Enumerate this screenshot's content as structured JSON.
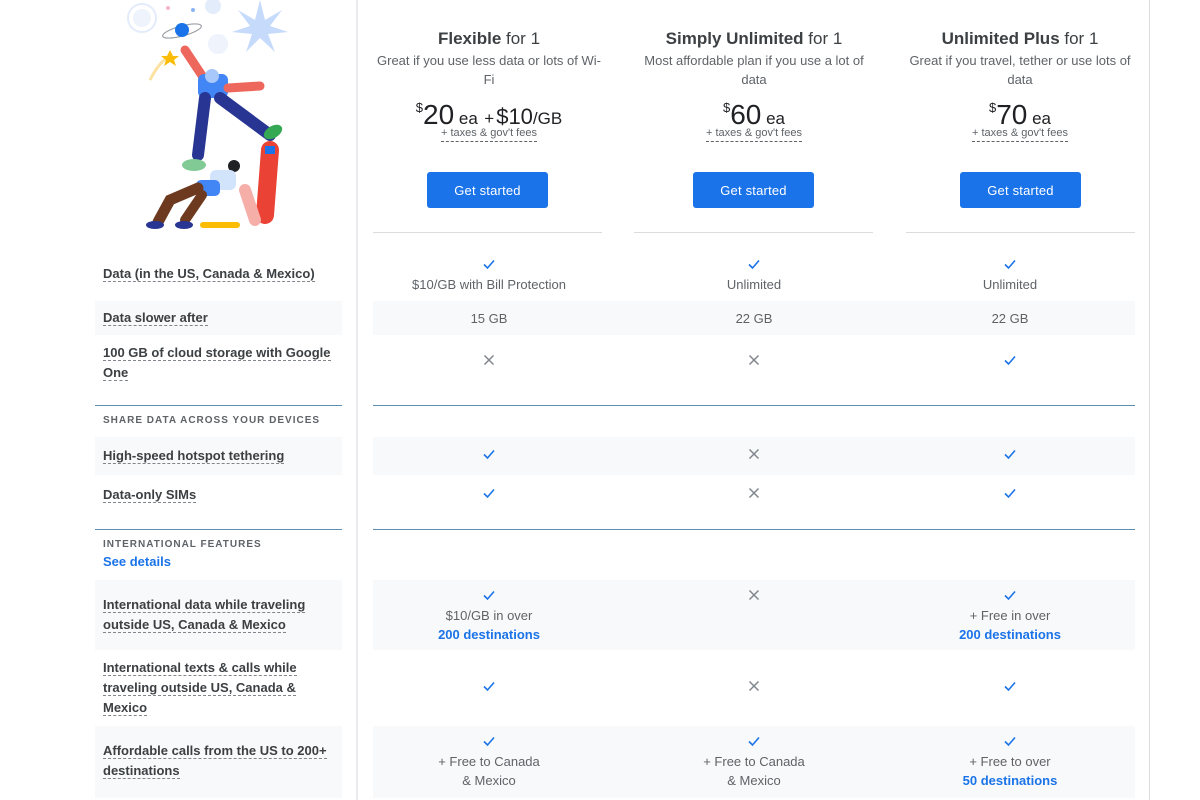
{
  "plans": [
    {
      "name": "Flexible",
      "suffix": " for 1",
      "description": "Great if you use less data or lots of Wi-Fi",
      "price_currency": "$",
      "price_amount": "20",
      "price_unit": " ea",
      "price_plus": "+",
      "price_extra": "$10",
      "price_extra_unit": "/GB",
      "fees": "+ taxes & gov't fees",
      "cta": "Get started"
    },
    {
      "name": "Simply Unlimited",
      "suffix": " for 1",
      "description": "Most affordable plan if you use a lot of data",
      "price_currency": "$",
      "price_amount": "60",
      "price_unit": " ea",
      "fees": "+ taxes & gov't fees",
      "cta": "Get started"
    },
    {
      "name": "Unlimited Plus",
      "suffix": " for 1",
      "description": "Great if you travel, tether or use lots of data",
      "price_currency": "$",
      "price_amount": "70",
      "price_unit": " ea",
      "fees": "+ taxes & gov't fees",
      "cta": "Get started"
    }
  ],
  "sections": {
    "share": "SHARE DATA ACROSS YOUR DEVICES",
    "international": "INTERNATIONAL FEATURES",
    "see_details": "See details"
  },
  "features": [
    {
      "label": "Data (in the US, Canada & Mexico)",
      "cells": [
        {
          "icon": "check",
          "text": "$10/GB with Bill Protection"
        },
        {
          "icon": "check",
          "text": "Unlimited"
        },
        {
          "icon": "check",
          "text": "Unlimited"
        }
      ]
    },
    {
      "label": "Data slower after",
      "cells": [
        {
          "text": "15 GB"
        },
        {
          "text": "22 GB"
        },
        {
          "text": "22 GB"
        }
      ]
    },
    {
      "label": "100 GB of cloud storage with Google One",
      "cells": [
        {
          "icon": "cross"
        },
        {
          "icon": "cross"
        },
        {
          "icon": "check"
        }
      ]
    },
    {
      "label": "High-speed hotspot tethering",
      "cells": [
        {
          "icon": "check"
        },
        {
          "icon": "cross"
        },
        {
          "icon": "check"
        }
      ]
    },
    {
      "label": "Data-only SIMs",
      "cells": [
        {
          "icon": "check"
        },
        {
          "icon": "cross"
        },
        {
          "icon": "check"
        }
      ]
    },
    {
      "label": "International data while traveling outside US, Canada & Mexico",
      "cells": [
        {
          "icon": "check",
          "text": "$10/GB in over",
          "link": "200 destinations"
        },
        {
          "icon": "cross"
        },
        {
          "icon": "check",
          "text": "+ Free in over",
          "link": "200 destinations"
        }
      ]
    },
    {
      "label": "International texts & calls while traveling outside US, Canada & Mexico",
      "cells": [
        {
          "icon": "check"
        },
        {
          "icon": "cross"
        },
        {
          "icon": "check"
        }
      ]
    },
    {
      "label": "Affordable calls from the US to 200+ destinations",
      "cells": [
        {
          "icon": "check",
          "text": "+ Free to Canada",
          "text2": "& Mexico"
        },
        {
          "icon": "check",
          "text": "+ Free to Canada",
          "text2": "& Mexico"
        },
        {
          "icon": "check",
          "text": "+ Free to over",
          "link": "50 destinations"
        }
      ]
    }
  ],
  "colors": {
    "accent": "#1a73e8",
    "check": "#1a73e8",
    "cross": "#80868b",
    "row_bg": "#f8f9fa"
  }
}
